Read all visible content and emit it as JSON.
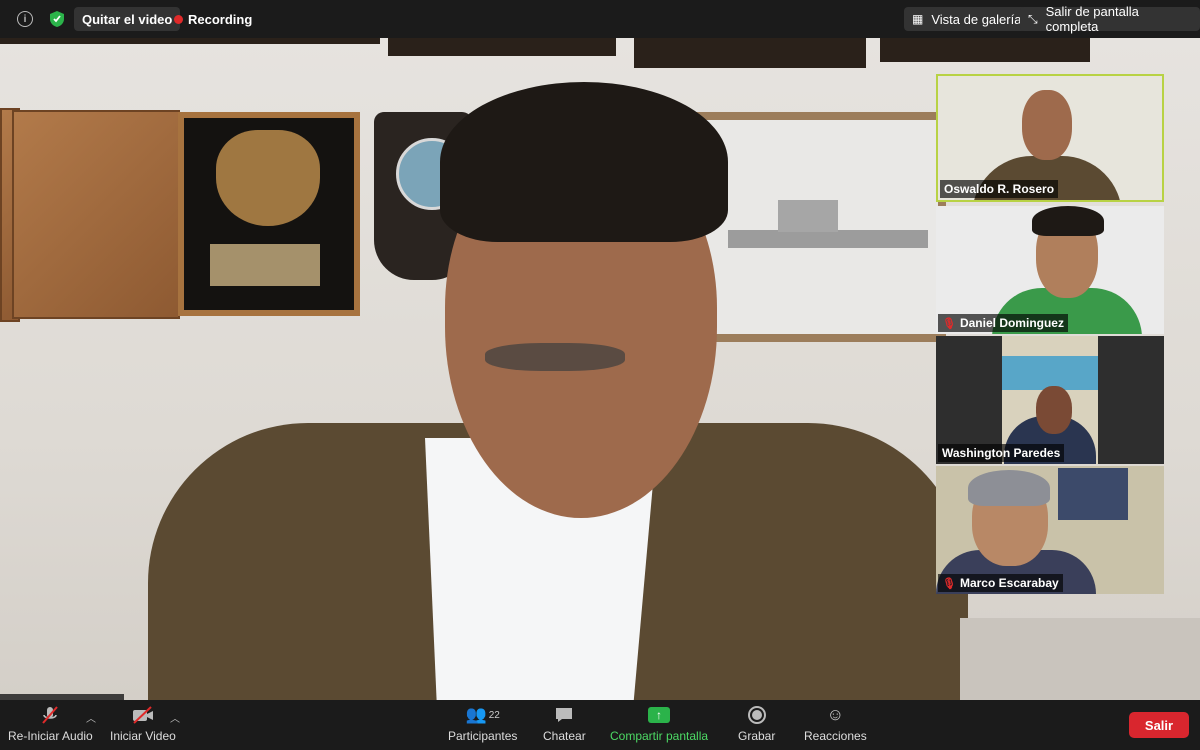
{
  "topbar": {
    "info_icon": "info-icon",
    "security_icon": "shield-check-icon",
    "stop_video_label": "Quitar el video",
    "recording_label": "Recording",
    "gallery_label": "Vista de galería",
    "exit_fullscreen_label": "Salir de pantalla completa"
  },
  "participants_panel": [
    {
      "name": "Oswaldo R. Rosero",
      "muted": false,
      "active": true
    },
    {
      "name": "Daniel Dominguez",
      "muted": true,
      "active": false
    },
    {
      "name": "Washington Paredes",
      "muted": false,
      "active": false
    },
    {
      "name": "Marco Escarabay",
      "muted": true,
      "active": false
    }
  ],
  "toolbar": {
    "audio_label": "Re-Iniciar Audio",
    "video_label": "Iniciar Video",
    "participants_label": "Participantes",
    "participants_count": "22",
    "chat_label": "Chatear",
    "share_label": "Compartir pantalla",
    "record_label": "Grabar",
    "reactions_label": "Reacciones",
    "leave_label": "Salir"
  },
  "colors": {
    "accent_green": "#2bb34a",
    "leave_red": "#d9262e",
    "active_speaker_border": "#b8d244",
    "recording_dot": "#e02a2a"
  }
}
